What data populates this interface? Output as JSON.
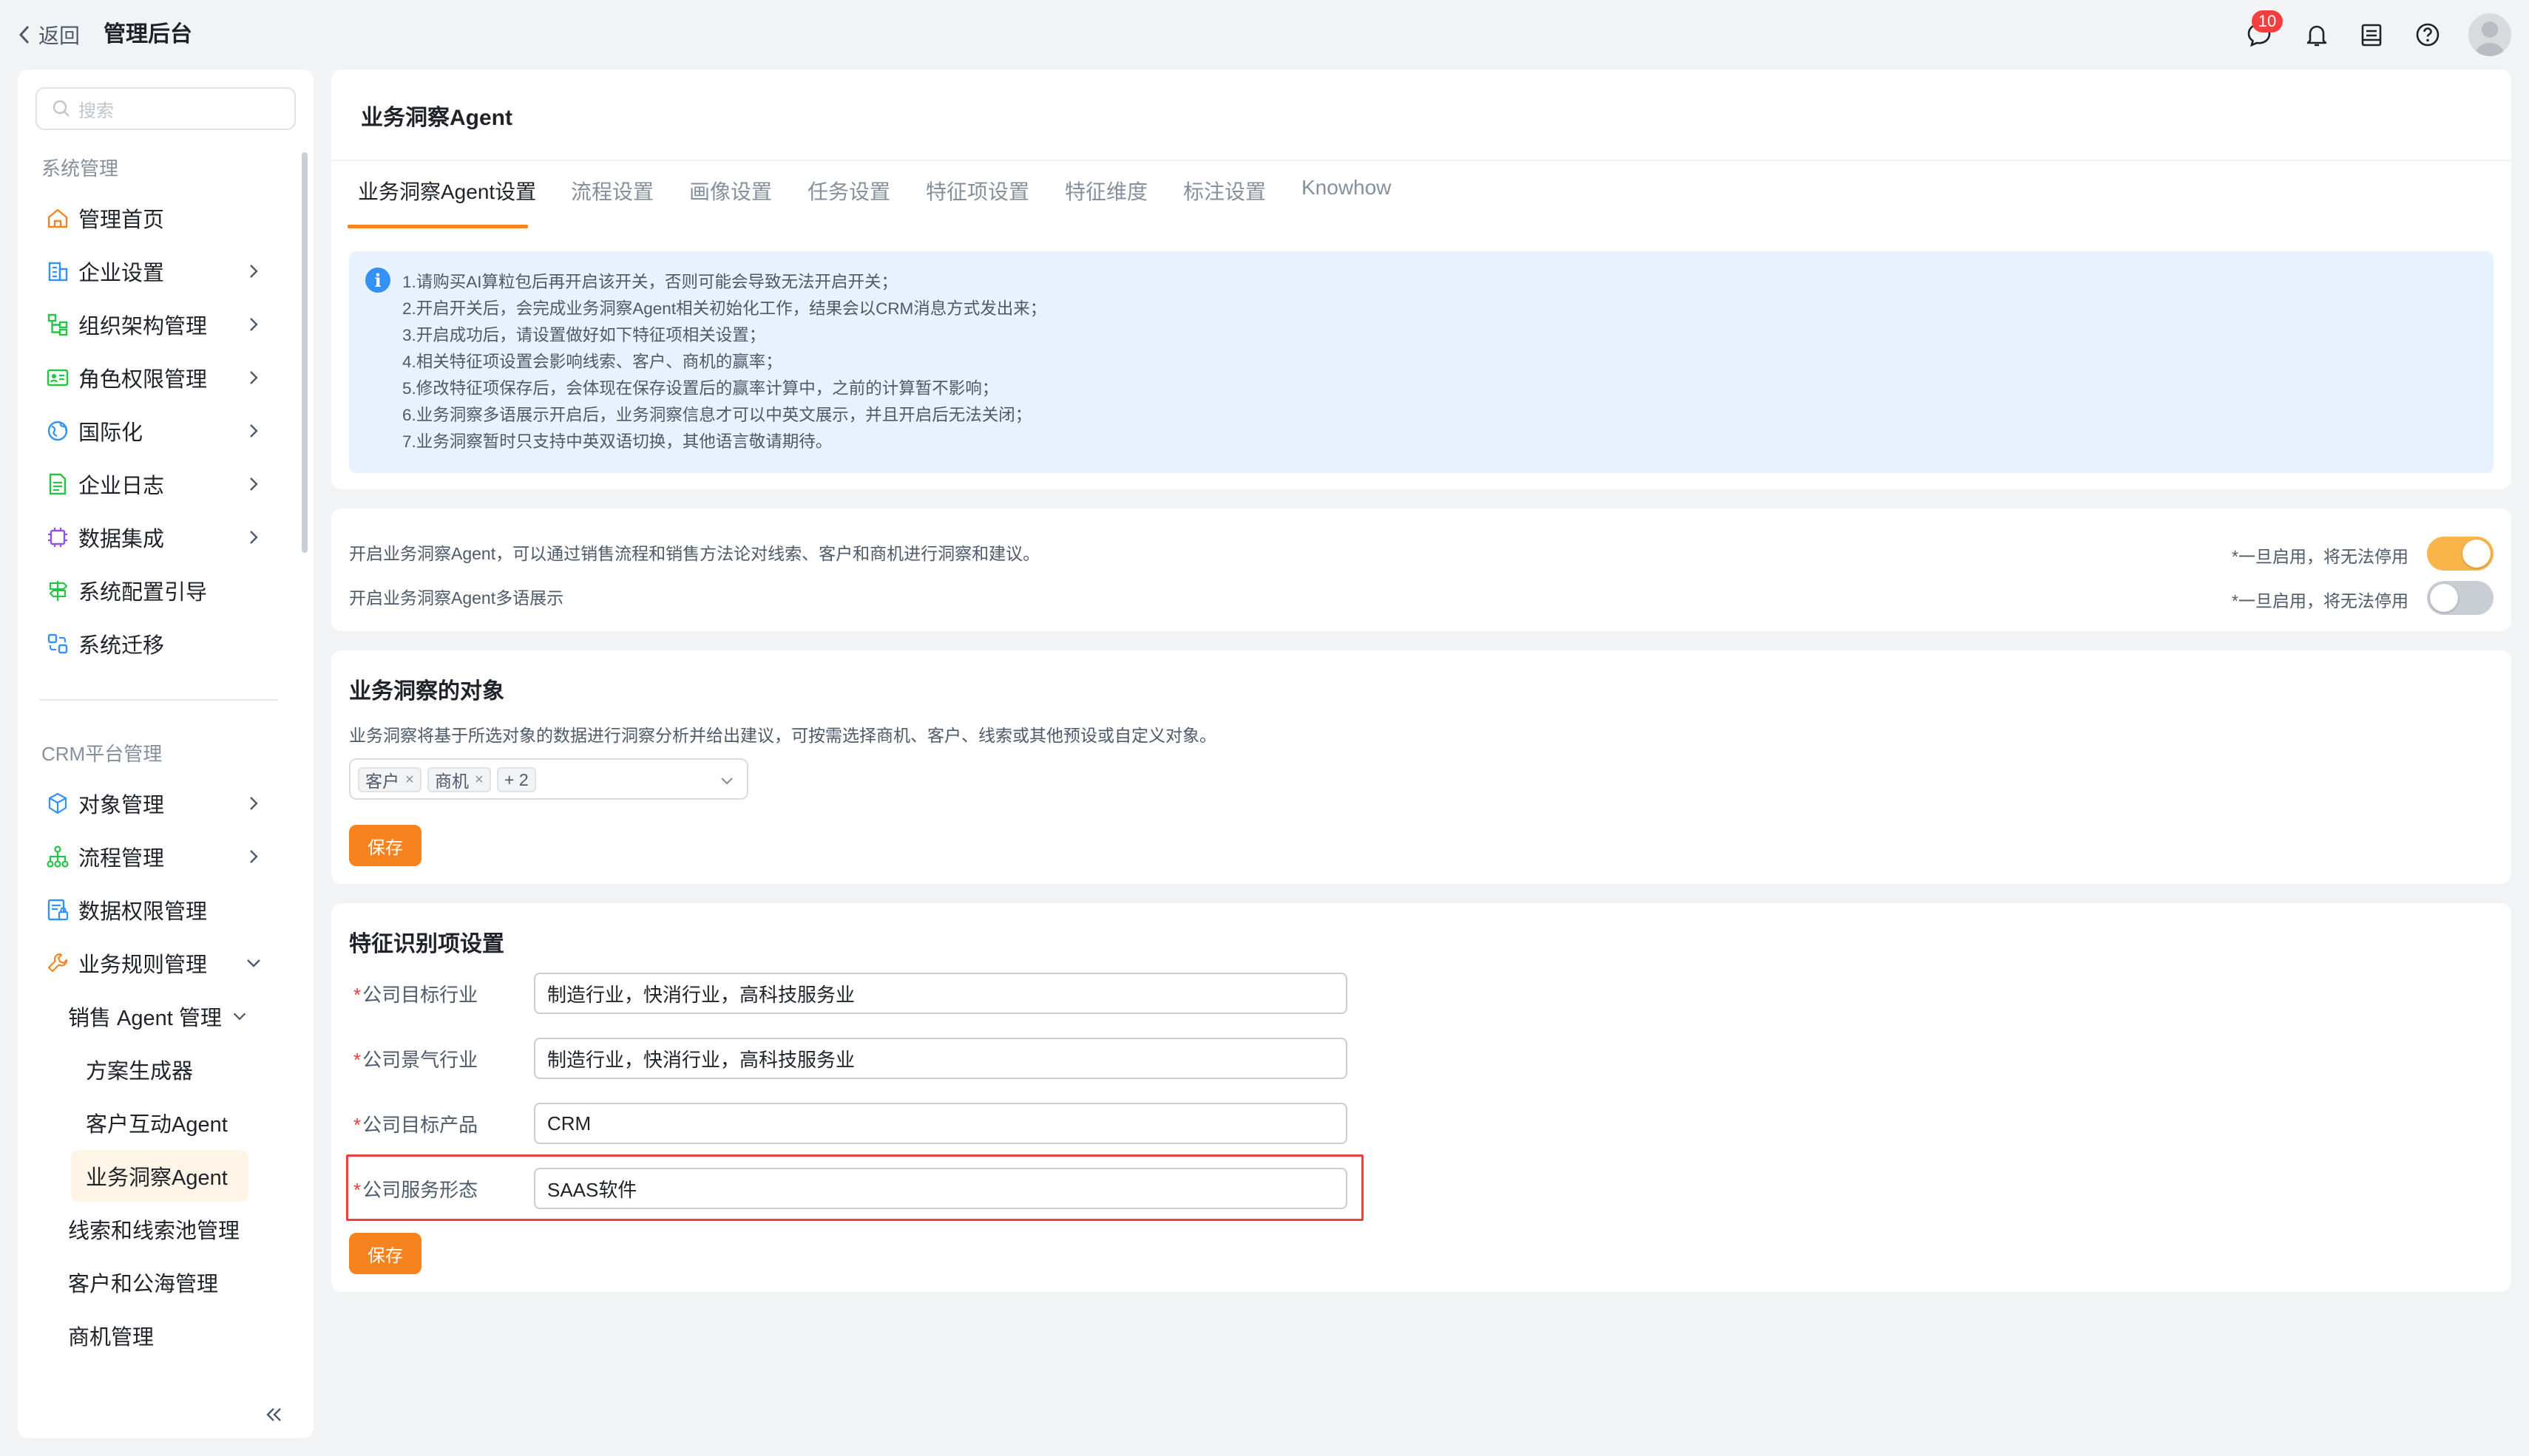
{
  "topbar": {
    "back_label": "返回",
    "app_title": "管理后台",
    "message_badge": "10",
    "icons": [
      "message-icon",
      "bell-icon",
      "inbox-icon",
      "help-icon",
      "avatar"
    ]
  },
  "sidebar": {
    "search_placeholder": "搜索",
    "group1": "系统管理",
    "items1": [
      {
        "label": "管理首页",
        "icon": "home-icon"
      },
      {
        "label": "企业设置",
        "icon": "building-icon"
      },
      {
        "label": "组织架构管理",
        "icon": "org-chart-icon"
      },
      {
        "label": "角色权限管理",
        "icon": "id-card-icon"
      },
      {
        "label": "国际化",
        "icon": "globe-icon"
      },
      {
        "label": "企业日志",
        "icon": "log-icon"
      },
      {
        "label": "数据集成",
        "icon": "chip-icon"
      },
      {
        "label": "系统配置引导",
        "icon": "signpost-icon"
      },
      {
        "label": "系统迁移",
        "icon": "migrate-icon"
      }
    ],
    "group2": "CRM平台管理",
    "items2": [
      {
        "label": "对象管理",
        "icon": "cube-icon"
      },
      {
        "label": "流程管理",
        "icon": "flow-icon"
      },
      {
        "label": "数据权限管理",
        "icon": "data-lock-icon"
      },
      {
        "label": "业务规则管理",
        "icon": "wrench-icon"
      }
    ],
    "sales_agent": "销售 Agent 管理",
    "sales_children": [
      "方案生成器",
      "客户互动Agent",
      "业务洞察Agent"
    ],
    "more_items": [
      "线索和线索池管理",
      "客户和公海管理",
      "商机管理"
    ]
  },
  "page": {
    "title": "业务洞察Agent",
    "tabs": [
      "业务洞察Agent设置",
      "流程设置",
      "画像设置",
      "任务设置",
      "特征项设置",
      "特征维度",
      "标注设置",
      "Knowhow"
    ],
    "notice": [
      "1.请购买AI算粒包后再开启该开关，否则可能会导致无法开启开关；",
      "2.开启开关后，会完成业务洞察Agent相关初始化工作，结果会以CRM消息方式发出来；",
      "3.开启成功后，请设置做好如下特征项相关设置；",
      "4.相关特征项设置会影响线索、客户、商机的赢率；",
      "5.修改特征项保存后，会体现在保存设置后的赢率计算中，之前的计算暂不影响；",
      "6.业务洞察多语展示开启后，业务洞察信息才可以中英文展示，并且开启后无法关闭；",
      "7.业务洞察暂时只支持中英双语切换，其他语言敬请期待。"
    ]
  },
  "toggles": [
    {
      "label": "开启业务洞察Agent，可以通过销售流程和销售方法论对线索、客户和商机进行洞察和建议。",
      "warn": "*一旦启用，将无法停用",
      "on": true
    },
    {
      "label": "开启业务洞察Agent多语展示",
      "warn": "*一旦启用，将无法停用",
      "on": false
    }
  ],
  "objects": {
    "title": "业务洞察的对象",
    "desc": "业务洞察将基于所选对象的数据进行洞察分析并给出建议，可按需选择商机、客户、线索或其他预设或自定义对象。",
    "chips": [
      "客户",
      "商机"
    ],
    "more": "+ 2",
    "save": "保存"
  },
  "features": {
    "title": "特征识别项设置",
    "required_mark": "*",
    "fields": [
      {
        "label": "公司目标行业",
        "value": "制造行业，快消行业，高科技服务业"
      },
      {
        "label": "公司景气行业",
        "value": "制造行业，快消行业，高科技服务业"
      },
      {
        "label": "公司目标产品",
        "value": "CRM"
      },
      {
        "label": "公司服务形态",
        "value": "SAAS软件"
      }
    ],
    "save": "保存"
  },
  "colors": {
    "accent": "#f7831f",
    "notice_bg": "#e8f2fe",
    "info": "#3491fa",
    "toggle_on": "#f9b54a",
    "toggle_off": "#c9cdd4",
    "highlight": "#f53f3f"
  }
}
